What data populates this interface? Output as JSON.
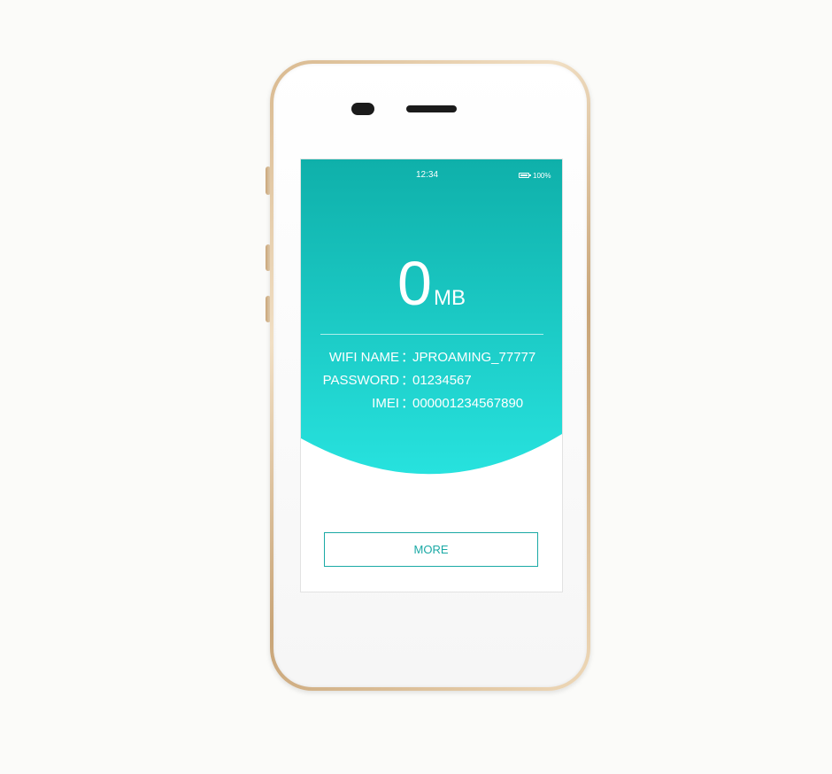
{
  "status_bar": {
    "time": "12:34",
    "battery_percent": "100%",
    "battery_icon": "battery-full-icon"
  },
  "usage": {
    "value": "0",
    "unit": "MB"
  },
  "info": [
    {
      "label": "WIFI NAME",
      "separator": "：",
      "value": "JPROAMING_77777"
    },
    {
      "label": "PASSWORD",
      "separator": "：",
      "value": "01234567"
    },
    {
      "label": "IMEI",
      "separator": "：",
      "value": "000001234567890"
    }
  ],
  "more_button": {
    "label": "MORE"
  },
  "colors": {
    "teal_top": "#0fb0aa",
    "teal_bottom": "#27e2de",
    "button_accent": "#1aa9a5"
  }
}
